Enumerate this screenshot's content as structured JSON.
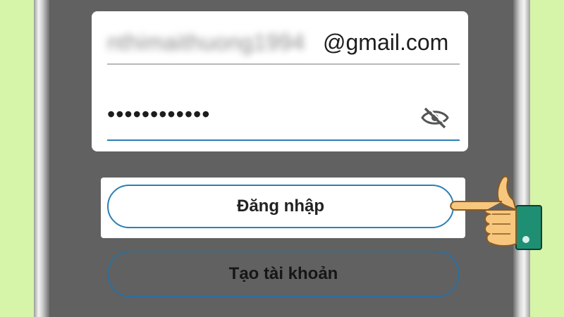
{
  "login_form": {
    "email_hidden_part": "nthimaithuong1994",
    "email_domain": "@gmail.com",
    "password_masked": "••••••••••••",
    "login_button_label": "Đăng nhập",
    "create_account_label": "Tạo tài khoản"
  },
  "colors": {
    "background": "#d6f5a8",
    "screen": "#616161",
    "accent": "#2b7fb6",
    "hand_skin": "#f7c77e",
    "cuff": "#1f8f73"
  },
  "icons": {
    "password_visibility": "eye-off-icon",
    "pointer": "pointing-hand-icon"
  }
}
